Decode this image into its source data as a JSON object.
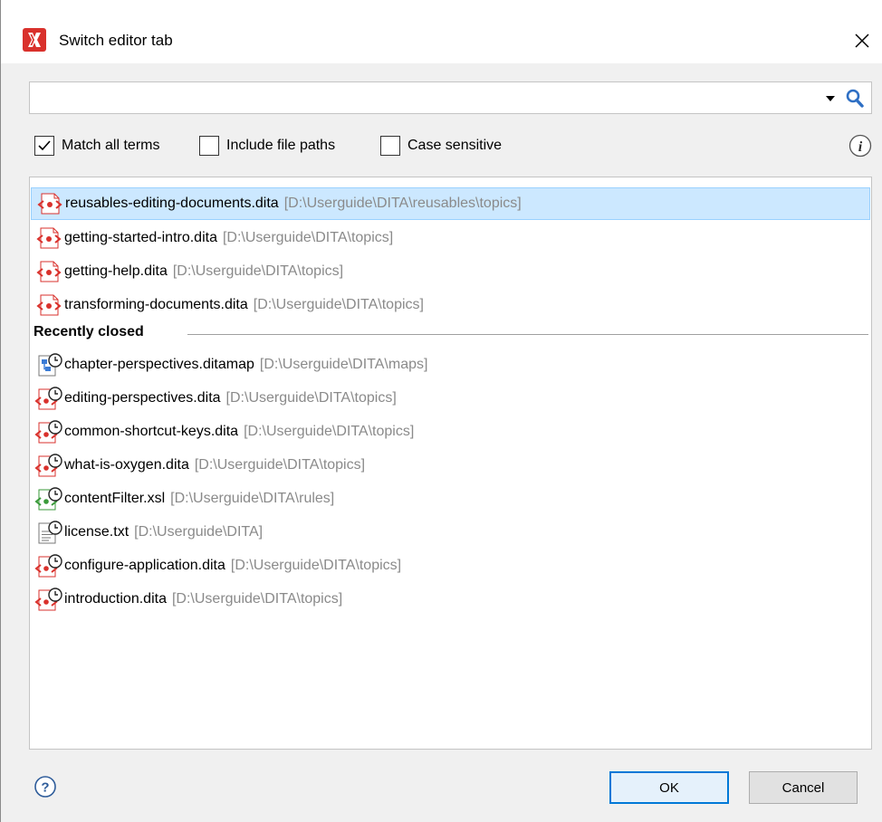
{
  "window": {
    "title": "Switch editor tab"
  },
  "search": {
    "value": "",
    "placeholder": ""
  },
  "options": [
    {
      "label": "Match all terms",
      "checked": true
    },
    {
      "label": "Include file paths",
      "checked": false
    },
    {
      "label": "Case sensitive",
      "checked": false
    }
  ],
  "open_files": [
    {
      "name": "reusables-editing-documents.dita",
      "path": "[D:\\Userguide\\DITA\\reusables\\topics]",
      "icon": "dita-topic-icon",
      "selected": true
    },
    {
      "name": "getting-started-intro.dita",
      "path": "[D:\\Userguide\\DITA\\topics]",
      "icon": "dita-topic-icon",
      "selected": false
    },
    {
      "name": "getting-help.dita",
      "path": "[D:\\Userguide\\DITA\\topics]",
      "icon": "dita-topic-icon",
      "selected": false
    },
    {
      "name": "transforming-documents.dita",
      "path": "[D:\\Userguide\\DITA\\topics]",
      "icon": "dita-topic-icon",
      "selected": false
    }
  ],
  "recently_closed": {
    "label": "Recently closed",
    "items": [
      {
        "name": "chapter-perspectives.ditamap",
        "path": "[D:\\Userguide\\DITA\\maps]",
        "icon": "ditamap-recent-icon"
      },
      {
        "name": "editing-perspectives.dita",
        "path": "[D:\\Userguide\\DITA\\topics]",
        "icon": "dita-recent-icon"
      },
      {
        "name": "common-shortcut-keys.dita",
        "path": "[D:\\Userguide\\DITA\\topics]",
        "icon": "dita-recent-icon"
      },
      {
        "name": "what-is-oxygen.dita",
        "path": "[D:\\Userguide\\DITA\\topics]",
        "icon": "dita-recent-icon"
      },
      {
        "name": "contentFilter.xsl",
        "path": "[D:\\Userguide\\DITA\\rules]",
        "icon": "xsl-recent-icon"
      },
      {
        "name": "license.txt",
        "path": "[D:\\Userguide\\DITA]",
        "icon": "text-recent-icon"
      },
      {
        "name": "configure-application.dita",
        "path": "[D:\\Userguide\\DITA\\topics]",
        "icon": "dita-recent-icon"
      },
      {
        "name": "introduction.dita",
        "path": "[D:\\Userguide\\DITA\\topics]",
        "icon": "dita-recent-icon"
      }
    ]
  },
  "buttons": {
    "ok": "OK",
    "cancel": "Cancel"
  },
  "colors": {
    "accent": "#0078d7",
    "selection": "#cce8ff",
    "dita_red": "#d9312c",
    "xsl_green": "#3a9a3a",
    "path_gray": "#8a8a8a"
  },
  "icons": {
    "app": "oxygen-app-icon",
    "close": "close-icon",
    "search": "search-icon",
    "dropdown": "dropdown-arrow-icon",
    "info": "info-icon",
    "help": "help-icon"
  }
}
